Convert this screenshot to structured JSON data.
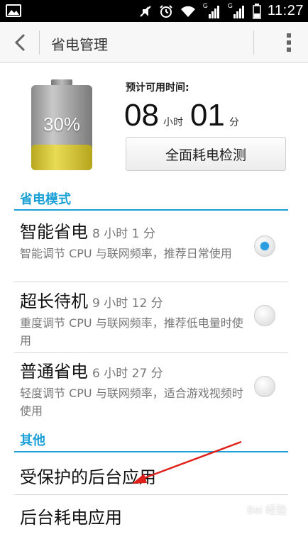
{
  "status_bar": {
    "time": "11:27",
    "network_type_1": "G",
    "network_type_2": "G"
  },
  "action_bar": {
    "title": "省电管理"
  },
  "battery": {
    "percent_label": "30%",
    "level": 0.3,
    "estimate_label": "预计可用时间:",
    "hours": "08",
    "hours_unit": "小时",
    "minutes": "01",
    "minutes_unit": "分",
    "check_button": "全面耗电检测"
  },
  "modes_section": {
    "header": "省电模式",
    "items": [
      {
        "title": "智能省电",
        "duration": "8 小时 1 分",
        "desc": "智能调节 CPU 与联网频率，推荐日常使用",
        "selected": true
      },
      {
        "title": "超长待机",
        "duration": "9 小时 12 分",
        "desc": "重度调节 CPU 与联网频率，推荐低电量时使用",
        "selected": false
      },
      {
        "title": "普通省电",
        "duration": "6 小时 27 分",
        "desc": "轻度调节 CPU 与联网频率，适合游戏视频时使用",
        "selected": false
      }
    ]
  },
  "other_section": {
    "header": "其他",
    "items": [
      {
        "label": "受保护的后台应用"
      },
      {
        "label": "后台耗电应用"
      }
    ]
  },
  "watermark": "Bai 经验",
  "colors": {
    "accent": "#1a9fd6",
    "radio_selected": "#2a9ee0",
    "battery_fill": "#d9c83a",
    "arrow": "#e0201b"
  }
}
